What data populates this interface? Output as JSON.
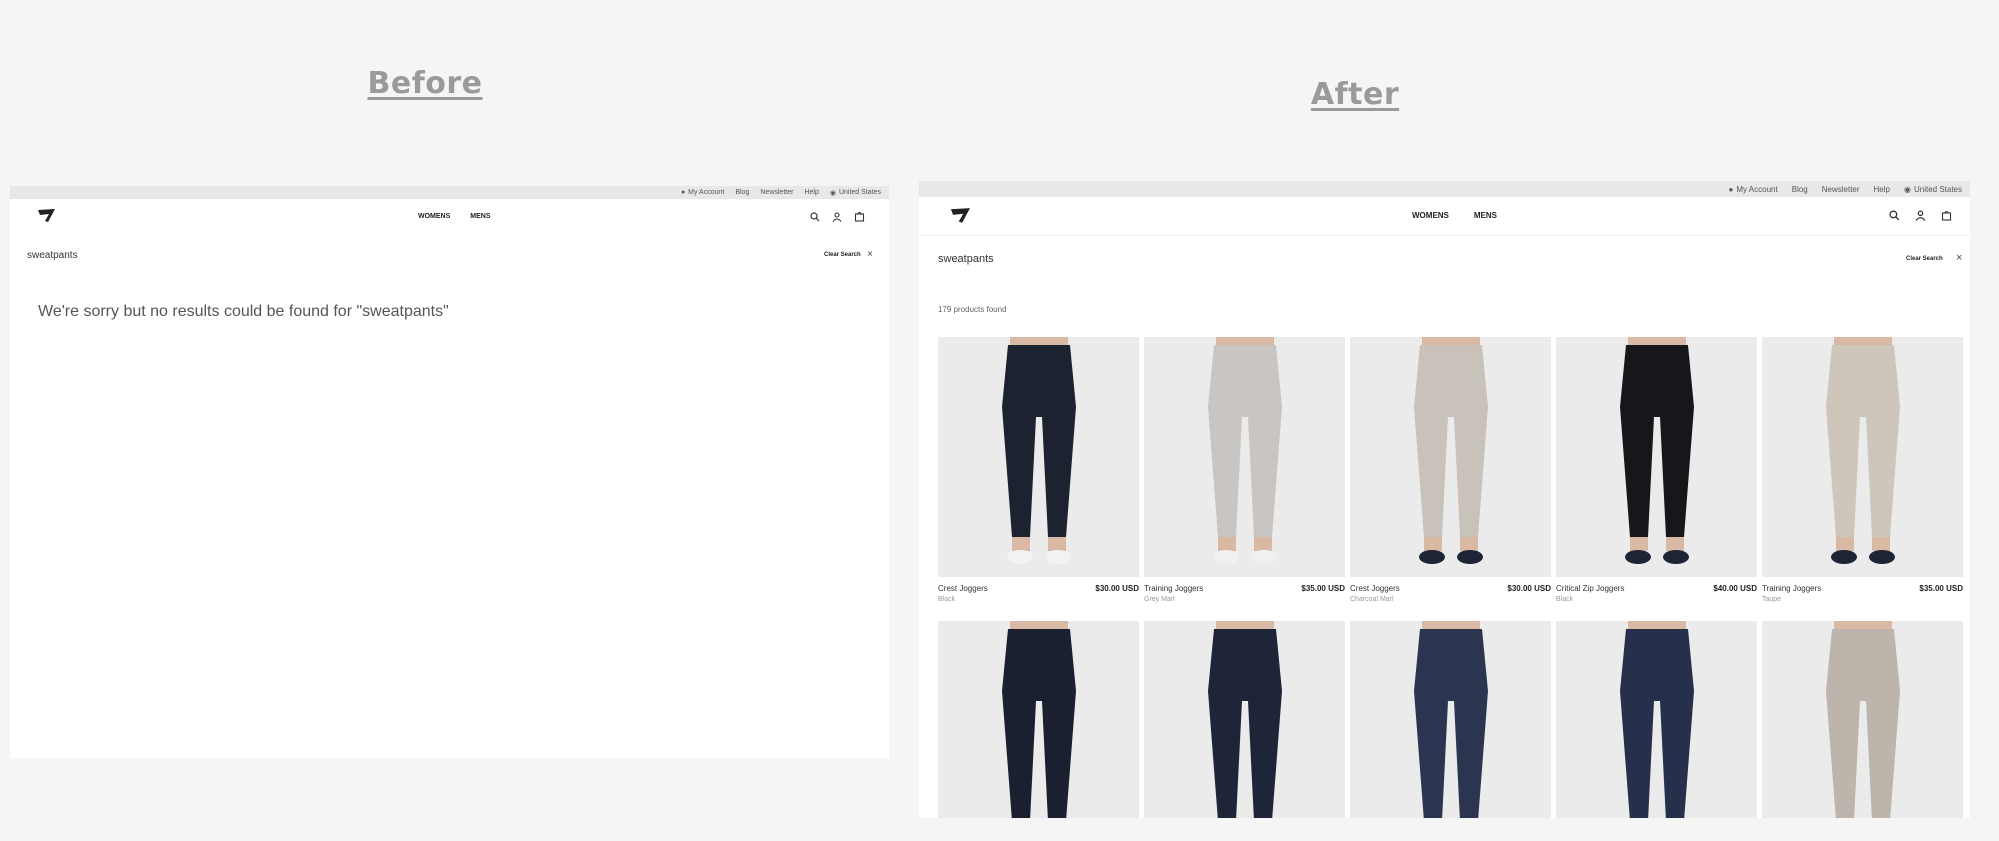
{
  "before": {
    "heading": "Before",
    "topbar": [
      "My Account",
      "Blog",
      "Newsletter",
      "Help",
      "United States"
    ],
    "nav": [
      "WOMENS",
      "MENS"
    ],
    "search_term": "sweatpants",
    "clear_label": "Clear Search",
    "no_results": "We're sorry but no results could be found for \"sweatpants\""
  },
  "after": {
    "heading": "After",
    "topbar": [
      "My Account",
      "Blog",
      "Newsletter",
      "Help",
      "United States"
    ],
    "nav": [
      "WOMENS",
      "MENS"
    ],
    "search_term": "sweatpants",
    "clear_label": "Clear Search",
    "count": "179 products found",
    "products": [
      {
        "name": "Crest Joggers",
        "price": "$30.00 USD",
        "color": "Black",
        "swatch": "#1c2230",
        "shoe": "#f2f2f2"
      },
      {
        "name": "Training Joggers",
        "price": "$35.00 USD",
        "color": "Grey Marl",
        "swatch": "#c9c5c2",
        "shoe": "#f0f0f0"
      },
      {
        "name": "Crest Joggers",
        "price": "$30.00 USD",
        "color": "Charcoal Marl",
        "swatch": "#c8c2ba",
        "shoe": "#1d2433"
      },
      {
        "name": "Critical Zip Joggers",
        "price": "$40.00 USD",
        "color": "Black",
        "swatch": "#16171b",
        "shoe": "#1d2433"
      },
      {
        "name": "Training Joggers",
        "price": "$35.00 USD",
        "color": "Taupe",
        "swatch": "#cfc6bb",
        "shoe": "#1d2433"
      },
      {
        "swatch": "#1b2030",
        "shoe": "#1d2433"
      },
      {
        "swatch": "#1e2538",
        "shoe": "#1d2433"
      },
      {
        "swatch": "#2b3550",
        "shoe": "#1d2433"
      },
      {
        "swatch": "#26304b",
        "shoe": "#1d2433"
      },
      {
        "swatch": "#bdb5ab",
        "shoe": "#1d2433"
      }
    ]
  }
}
